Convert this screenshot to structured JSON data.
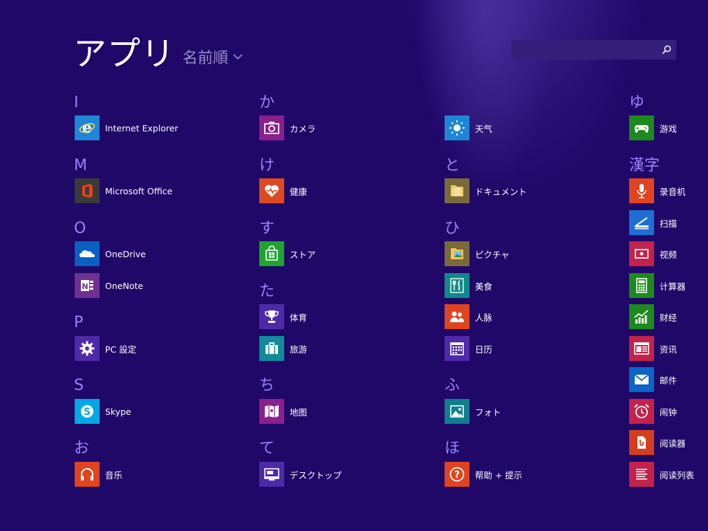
{
  "header": {
    "title": "アプリ",
    "sort_label": "名前順"
  },
  "search": {
    "placeholder": ""
  },
  "colors": {
    "background": "#1f0868",
    "letter": "#9d84ff",
    "ie": "#1d86d6",
    "office": "#3a3a3a",
    "onedrive": "#0a5fc3",
    "onenote": "#6f3091",
    "pc_settings": "#4f2aa8",
    "skype": "#00a8e6",
    "music": "#e0441f",
    "camera": "#8b1f8e",
    "health": "#dd4a1f",
    "store": "#20a32f",
    "sports": "#4f2aa8",
    "travel": "#118a9a",
    "maps": "#8b1f8e",
    "desktop": "#4f2aa8",
    "weather": "#1f86d6",
    "documents": "#7a6a3a",
    "pictures": "#7a6a3a",
    "food": "#0f8a8a",
    "people": "#e0441f",
    "calendar": "#4f2aa8",
    "photos": "#0f7f8f",
    "help": "#e0441f",
    "games": "#1c8a1c",
    "recorder": "#e0441f",
    "scan": "#1d6fd6",
    "video": "#c4224a",
    "calculator": "#1c8a1c",
    "finance": "#1c8a1c",
    "news": "#c4224a",
    "mail": "#0a65c4",
    "alarms": "#c4224a",
    "reader": "#d43e1e",
    "reading_list": "#c4224a"
  },
  "columns": [
    {
      "groups": [
        {
          "letter": "I",
          "apps": [
            {
              "label": "Internet Explorer",
              "icon": "ie-icon"
            }
          ]
        },
        {
          "letter": "M",
          "apps": [
            {
              "label": "Microsoft Office",
              "icon": "office-icon"
            }
          ]
        },
        {
          "letter": "O",
          "apps": [
            {
              "label": "OneDrive",
              "icon": "cloud-icon"
            },
            {
              "label": "OneNote",
              "icon": "onenote-icon"
            }
          ]
        },
        {
          "letter": "P",
          "apps": [
            {
              "label": "PC 設定",
              "icon": "gear-icon"
            }
          ]
        },
        {
          "letter": "S",
          "apps": [
            {
              "label": "Skype",
              "icon": "skype-icon"
            }
          ]
        },
        {
          "letter": "お",
          "apps": [
            {
              "label": "音乐",
              "icon": "headphones-icon"
            }
          ]
        }
      ]
    },
    {
      "groups": [
        {
          "letter": "か",
          "apps": [
            {
              "label": "カメラ",
              "icon": "camera-icon"
            }
          ]
        },
        {
          "letter": "け",
          "apps": [
            {
              "label": "健康",
              "icon": "heart-icon"
            }
          ]
        },
        {
          "letter": "す",
          "apps": [
            {
              "label": "ストア",
              "icon": "store-icon"
            }
          ]
        },
        {
          "letter": "た",
          "apps": [
            {
              "label": "体育",
              "icon": "trophy-icon"
            },
            {
              "label": "旅游",
              "icon": "suitcase-icon"
            }
          ]
        },
        {
          "letter": "ち",
          "apps": [
            {
              "label": "地图",
              "icon": "map-icon"
            }
          ]
        },
        {
          "letter": "て",
          "apps": [
            {
              "label": "デスクトップ",
              "icon": "desktop-icon"
            }
          ]
        }
      ]
    },
    {
      "groups": [
        {
          "letter": "",
          "apps": [
            {
              "label": "天气",
              "icon": "sun-icon"
            }
          ]
        },
        {
          "letter": "と",
          "apps": [
            {
              "label": "ドキュメント",
              "icon": "folder-icon"
            }
          ]
        },
        {
          "letter": "ひ",
          "apps": [
            {
              "label": "ピクチャ",
              "icon": "pictures-folder-icon"
            },
            {
              "label": "美食",
              "icon": "cutlery-icon"
            },
            {
              "label": "人脉",
              "icon": "people-icon"
            },
            {
              "label": "日历",
              "icon": "calendar-icon"
            }
          ]
        },
        {
          "letter": "ふ",
          "apps": [
            {
              "label": "フォト",
              "icon": "photo-icon"
            }
          ]
        },
        {
          "letter": "ほ",
          "apps": [
            {
              "label": "帮助 + 提示",
              "icon": "question-icon"
            }
          ]
        }
      ]
    },
    {
      "groups": [
        {
          "letter": "ゆ",
          "apps": [
            {
              "label": "游戏",
              "icon": "gamepad-icon"
            }
          ]
        },
        {
          "letter": "漢字",
          "apps": [
            {
              "label": "录音机",
              "icon": "microphone-icon"
            },
            {
              "label": "扫描",
              "icon": "scanner-icon"
            },
            {
              "label": "视频",
              "icon": "video-icon"
            },
            {
              "label": "计算器",
              "icon": "calculator-icon"
            },
            {
              "label": "财经",
              "icon": "chart-icon"
            },
            {
              "label": "资讯",
              "icon": "news-icon"
            },
            {
              "label": "邮件",
              "icon": "mail-icon"
            },
            {
              "label": "闹钟",
              "icon": "alarm-icon"
            },
            {
              "label": "阅读器",
              "icon": "reader-icon"
            },
            {
              "label": "阅读列表",
              "icon": "list-icon"
            }
          ]
        }
      ]
    }
  ]
}
